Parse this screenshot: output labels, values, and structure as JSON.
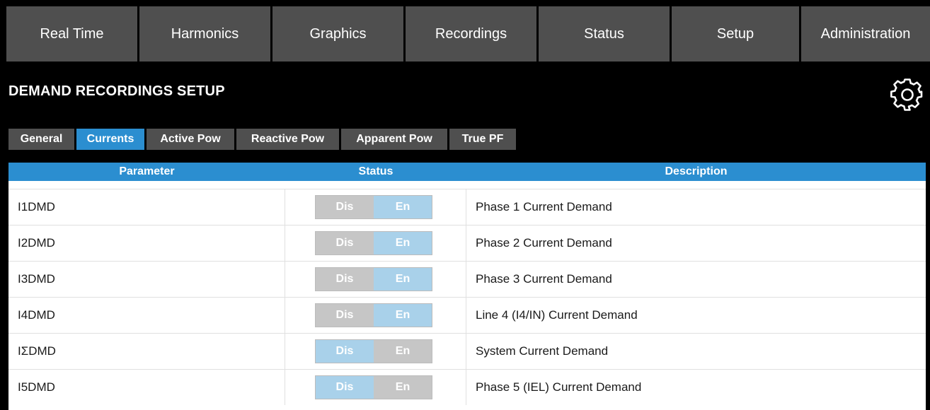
{
  "nav": {
    "items": [
      "Real Time",
      "Harmonics",
      "Graphics",
      "Recordings",
      "Status",
      "Setup",
      "Administration"
    ]
  },
  "page": {
    "title": "DEMAND RECORDINGS SETUP",
    "settings_icon": "gear-icon"
  },
  "subtabs": {
    "items": [
      "General",
      "Currents",
      "Active Pow",
      "Reactive Pow",
      "Apparent Pow",
      "True PF"
    ],
    "active": "Currents"
  },
  "table": {
    "headers": {
      "parameter": "Parameter",
      "status": "Status",
      "description": "Description"
    },
    "toggle_labels": {
      "disable": "Dis",
      "enable": "En"
    },
    "rows": [
      {
        "parameter": "I1DMD",
        "selected": "En",
        "description": "Phase 1 Current Demand"
      },
      {
        "parameter": "I2DMD",
        "selected": "En",
        "description": "Phase 2 Current Demand"
      },
      {
        "parameter": "I3DMD",
        "selected": "En",
        "description": "Phase 3 Current Demand"
      },
      {
        "parameter": "I4DMD",
        "selected": "En",
        "description": "Line 4 (I4/IN) Current Demand"
      },
      {
        "parameter": "IΣDMD",
        "selected": "Dis",
        "description": "System Current Demand"
      },
      {
        "parameter": "I5DMD",
        "selected": "Dis",
        "description": "Phase 5 (IEL) Current Demand"
      }
    ]
  },
  "colors": {
    "nav_bg": "#4f4f4f",
    "accent": "#2b8ed0",
    "toggle_selected": "#a9d1ea",
    "toggle_unselected": "#c6c6c6"
  }
}
